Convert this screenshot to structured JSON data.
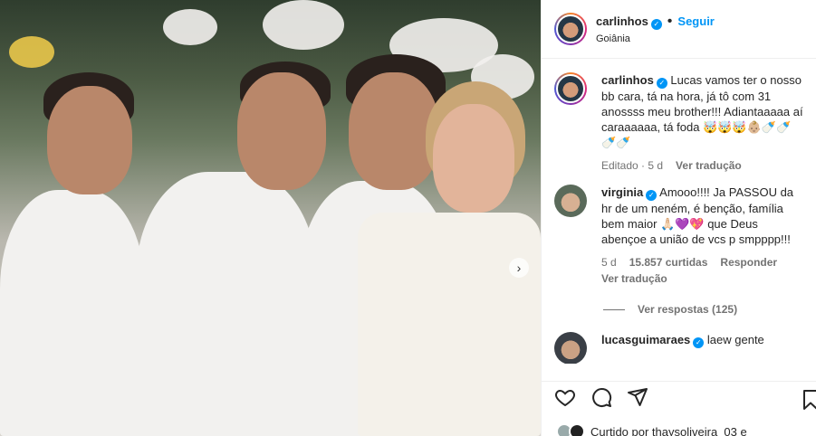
{
  "post": {
    "author": "carlinhos",
    "follow_label": "Seguir",
    "location": "Goiânia",
    "dot": "•"
  },
  "caption": {
    "user": "carlinhos",
    "text": "Lucas vamos ter o nosso bb cara, tá na hora, já tô com 31 anossss meu brother!!! Adiantaaaaa aí caraaaaaa, tá foda 🤯🤯🤯👶🏼🍼🍼🍼🍼",
    "edited": "Editado · 5 d",
    "see_translation": "Ver tradução"
  },
  "comments": [
    {
      "user": "virginia",
      "text": "Amooo!!!! Ja PASSOU da hr de um neném, é benção, família bem maior 🙏🏻💜💖 que Deus abençoe a união de vcs p smpppp!!!",
      "age": "5 d",
      "likes": "15.857 curtidas",
      "reply": "Responder",
      "see_translation": "Ver tradução",
      "view_replies": "Ver respostas (125)"
    },
    {
      "user": "lucasguimaraes",
      "text": "laew gente"
    }
  ],
  "footer": {
    "liked_by": "Curtido por thaysoliveira_03 e"
  },
  "icons": [
    "heart-icon",
    "comment-icon",
    "share-icon",
    "bookmark-icon",
    "verified-icon",
    "carousel-next-icon"
  ],
  "colors": {
    "accent": "#0095f6",
    "muted": "#737373",
    "text": "#262626"
  }
}
